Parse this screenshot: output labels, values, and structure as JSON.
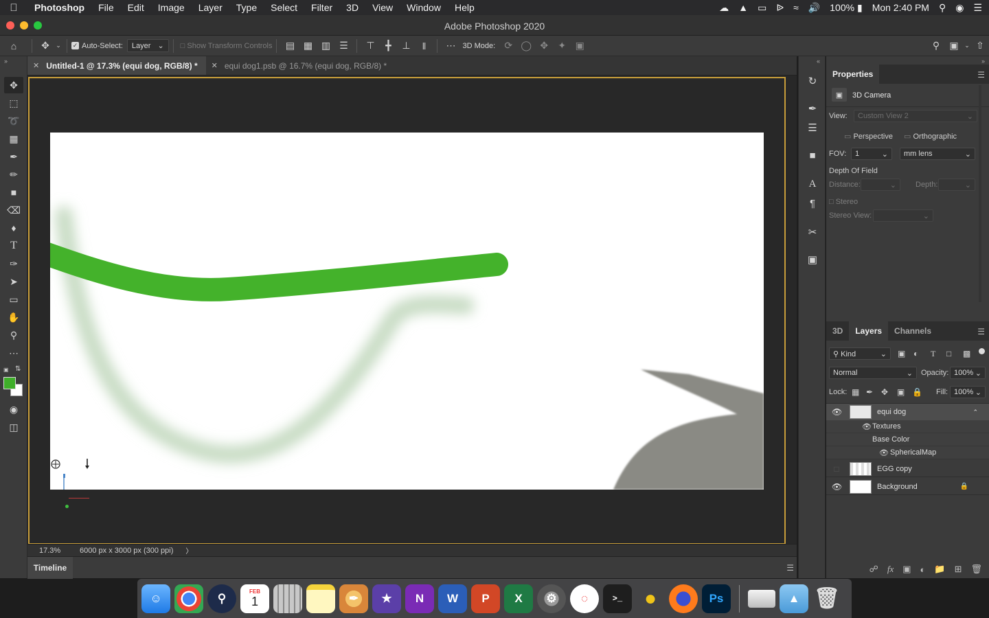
{
  "menubar": {
    "app_name": "Photoshop",
    "items": [
      "File",
      "Edit",
      "Image",
      "Layer",
      "Type",
      "Select",
      "Filter",
      "3D",
      "View",
      "Window",
      "Help"
    ],
    "battery": "100%",
    "clock": "Mon 2:40 PM"
  },
  "window": {
    "title": "Adobe Photoshop 2020"
  },
  "options": {
    "auto_select_label": "Auto-Select:",
    "auto_select_checked": true,
    "auto_select_value": "Layer",
    "show_transform_label": "Show Transform Controls",
    "mode_label": "3D Mode:"
  },
  "tabs": [
    {
      "label": "Untitled-1 @ 17.3% (equi dog, RGB/8) *",
      "active": true
    },
    {
      "label": "equi dog1.psb @ 16.7% (equi dog, RGB/8) *",
      "active": false
    }
  ],
  "status": {
    "zoom": "17.3%",
    "doc_info": "6000 px x 3000 px (300 ppi)",
    "arrow": "〉"
  },
  "timeline": {
    "label": "Timeline"
  },
  "colors": {
    "foreground": "#3fae2a",
    "background": "#ffffff",
    "stroke_green": "#44b22b",
    "pale_green": "#c8dcc4",
    "shape_gray": "#8a8a84",
    "frame": "#c89e3a"
  },
  "properties": {
    "tab": "Properties",
    "section": "3D Camera",
    "view_label": "View:",
    "view_value": "Custom View 2",
    "perspective": "Perspective",
    "orthographic": "Orthographic",
    "fov_label": "FOV:",
    "fov_value": "1",
    "lens_value": "mm lens",
    "dof_label": "Depth Of Field",
    "distance_label": "Distance:",
    "depth_label": "Depth:",
    "stereo_label": "Stereo",
    "stereo_view_label": "Stereo View:"
  },
  "layers_panel": {
    "tabs": [
      "3D",
      "Layers",
      "Channels"
    ],
    "active_tab": "Layers",
    "filter": "Kind",
    "blend_mode": "Normal",
    "opacity_label": "Opacity:",
    "opacity_value": "100%",
    "lock_label": "Lock:",
    "fill_label": "Fill:",
    "fill_value": "100%",
    "layers": [
      {
        "name": "equi dog",
        "visible": true,
        "selected": true
      },
      {
        "name": "EGG copy",
        "visible": false,
        "selected": false
      },
      {
        "name": "Background",
        "visible": true,
        "selected": false,
        "locked": true
      }
    ],
    "sub_items": {
      "textures": "Textures",
      "base_color": "Base Color",
      "spherical_map": "SphericalMap"
    }
  },
  "dock": {
    "apps": [
      "Finder",
      "Chrome",
      "QuickTime",
      "Calendar",
      "Calculator",
      "Notes",
      "Paintbrush",
      "iMovie",
      "OneNote",
      "Word",
      "PowerPoint",
      "Excel",
      "System Preferences",
      "News",
      "Terminal",
      "Cyberduck",
      "Firefox",
      "Photoshop"
    ],
    "calendar_month": "FEB",
    "calendar_day": "1",
    "ps_label": "Ps",
    "on_label": "N",
    "word_label": "W",
    "ppt_label": "P",
    "xl_label": "X"
  }
}
